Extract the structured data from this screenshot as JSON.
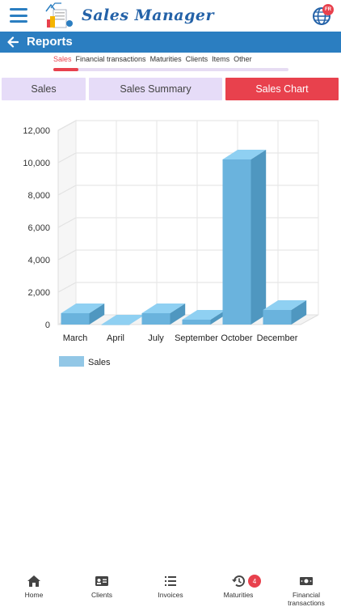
{
  "app": {
    "brand": "Sales Manager",
    "language_badge": "FR"
  },
  "header": {
    "title": "Reports"
  },
  "category_tabs": [
    {
      "label": "Sales",
      "active": true
    },
    {
      "label": "Financial transactions",
      "active": false
    },
    {
      "label": "Maturities",
      "active": false
    },
    {
      "label": "Clients",
      "active": false
    },
    {
      "label": "Items",
      "active": false
    },
    {
      "label": "Other",
      "active": false
    }
  ],
  "segments": [
    {
      "label": "Sales",
      "active": false
    },
    {
      "label": "Sales Summary",
      "active": false
    },
    {
      "label": "Sales Chart",
      "active": true
    }
  ],
  "colors": {
    "primary": "#2b7ec1",
    "accent": "#e8414d",
    "segment_bg": "#e6dcf8",
    "bar_front": "#6ab3dd",
    "bar_top": "#8fd0f2",
    "bar_side": "#4f97c0"
  },
  "chart_data": {
    "type": "bar",
    "categories": [
      "March",
      "April",
      "July",
      "September",
      "October",
      "December"
    ],
    "series": [
      {
        "name": "Sales",
        "values": [
          700,
          0,
          700,
          300,
          10200,
          900
        ]
      }
    ],
    "ylim": [
      0,
      12000
    ],
    "yticks": [
      0,
      2000,
      4000,
      6000,
      8000,
      10000,
      12000
    ],
    "ytick_labels": [
      "0",
      "2,000",
      "4,000",
      "6,000",
      "8,000",
      "10,000",
      "12,000"
    ],
    "grid": true,
    "three_d": true,
    "legend": "bottom-left"
  },
  "bottom_nav": [
    {
      "label": "Home",
      "icon": "home-icon"
    },
    {
      "label": "Clients",
      "icon": "id-card-icon"
    },
    {
      "label": "Invoices",
      "icon": "list-icon"
    },
    {
      "label": "Maturities",
      "icon": "history-icon",
      "badge": "4"
    },
    {
      "label": "Financial transactions",
      "icon": "money-icon"
    }
  ]
}
